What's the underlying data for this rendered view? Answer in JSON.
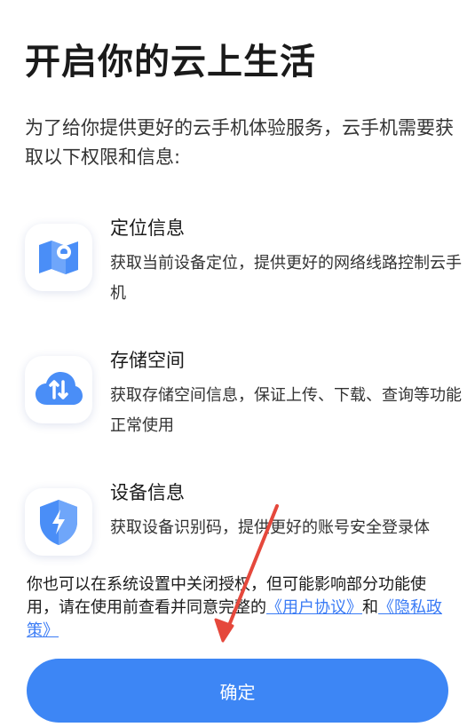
{
  "header": {
    "title": "开启你的云上生活"
  },
  "intro": {
    "text": "为了给你提供更好的云手机体验服务，云手机需要获取以下权限和信息:"
  },
  "permissions": [
    {
      "icon": "location-map-icon",
      "title": "定位信息",
      "desc": "获取当前设备定位，提供更好的网络线路控制云手机"
    },
    {
      "icon": "cloud-transfer-icon",
      "title": "存储空间",
      "desc": "获取存储空间信息，保证上传、下载、查询等功能正常使用"
    },
    {
      "icon": "security-shield-icon",
      "title": "设备信息",
      "desc": "获取设备识别码，提供更好的账号安全登录体"
    }
  ],
  "footer": {
    "text_before": "你也可以在系统设置中关闭授权，但可能影响部分功能使用，请在使用前查看并同意完整的",
    "user_agreement": "《用户协议》",
    "conjunction": "和",
    "privacy_policy": "《隐私政策》"
  },
  "confirm": {
    "label": "确定"
  },
  "colors": {
    "accent": "#3d86f5",
    "link": "#3a7bf5",
    "annotation_arrow": "#e5483c"
  }
}
